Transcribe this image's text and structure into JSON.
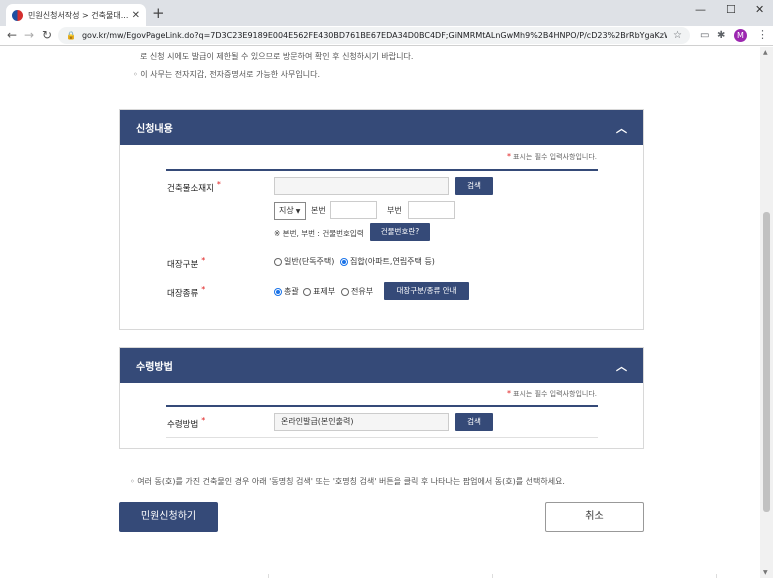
{
  "browser": {
    "tab_title": "민원신청서작성 > 건축물대...",
    "new_tab": "+",
    "url": "gov.kr/mw/EgovPageLink.do?q=7D3C23E9189E004E562FE430BD761BE67EDA34D0BC4DF;GiNMRMtALnGwMh9%2B4HNPO/P/cD23%2BrRbYgaKzWDSlRk%...",
    "profile_initial": "M"
  },
  "notices": {
    "line1": "로 신청 시에도 발급이 제한될 수 있으므로 방문하여 확인 후 신청하시기 바랍니다.",
    "line2": "이 사무는 전자지갑, 전자증명서로 가능한 사무입니다.",
    "bottom": "여러 동(호)를 가진 건축물인 경우 아래 '동명칭 검색' 또는 '호명칭 검색' 버튼을 클릭 후 나타나는 팝업에서 동(호)를 선택하세요."
  },
  "application": {
    "title": "신청내용",
    "required_note": "표시는 필수 입력사항입니다.",
    "address": {
      "label": "건축물소재지",
      "value": "",
      "search_button": "검색",
      "land_type": "지상",
      "main_no_label": "본번",
      "main_no": "",
      "sub_no_label": "부번",
      "sub_no": "",
      "hint": "※ 본번, 부번 : 건물번호입력",
      "building_no_button": "건물번호란?"
    },
    "target_type": {
      "label": "대장구분",
      "options": [
        "일반(단독주택)",
        "집합(아파트,연립주택 등)"
      ],
      "selected": "집합(아파트,연립주택 등)"
    },
    "target_kind": {
      "label": "대장종류",
      "options": [
        "총괄",
        "표제부",
        "전유부"
      ],
      "selected": "총괄",
      "guide_button": "대장구분/종류 안내"
    }
  },
  "receipt": {
    "title": "수령방법",
    "required_note": "표시는 필수 입력사항입니다.",
    "label": "수령방법",
    "value": "온라인발급(본인출력)",
    "search_button": "검색"
  },
  "actions": {
    "submit": "민원신청하기",
    "cancel": "취소"
  }
}
